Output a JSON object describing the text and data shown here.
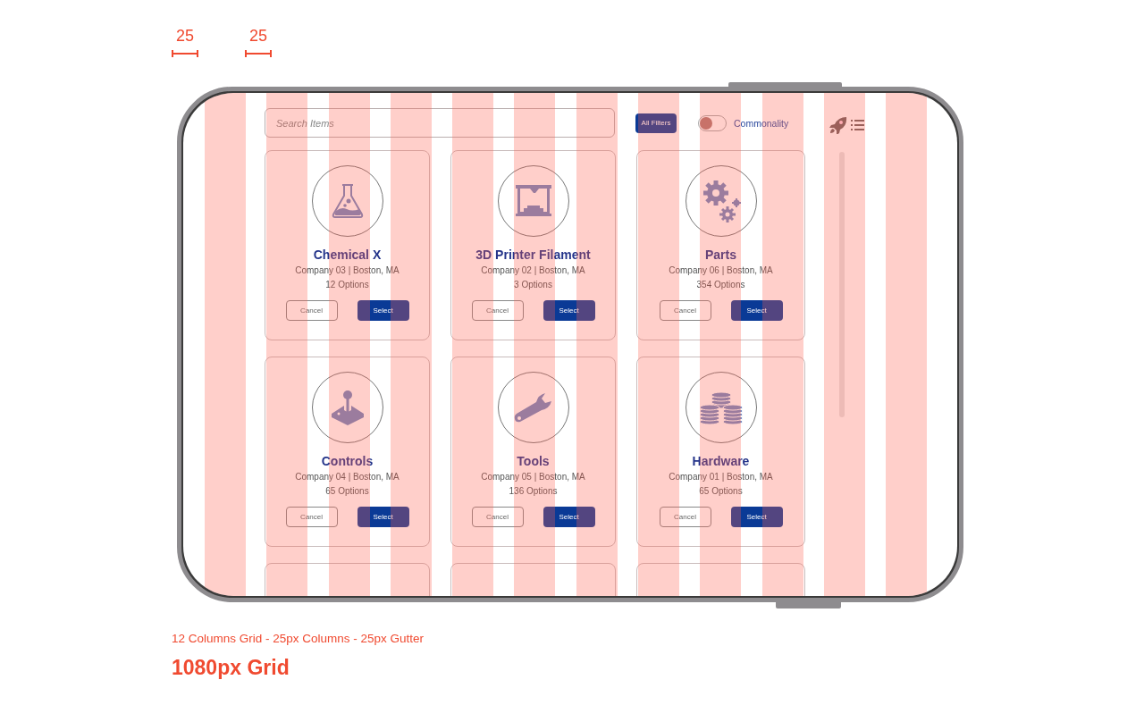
{
  "measure_labels": [
    "25",
    "25"
  ],
  "toolbar": {
    "search": {
      "placeholder": "Search Items"
    },
    "filters_button": "All Filters",
    "toggle": {
      "label": "Commonality",
      "on": false
    }
  },
  "cards": [
    {
      "kind": "item",
      "title": "Chemical X",
      "company": "Company 03 | Boston, MA",
      "options": "12 Options",
      "cancel_button": "Cancel",
      "select_button": "Select"
    },
    {
      "kind": "item",
      "title": "3D Printer Filament",
      "company": "Company 02 | Boston, MA",
      "options": "3 Options",
      "cancel_button": "Cancel",
      "select_button": "Select"
    },
    {
      "kind": "item",
      "title": "Parts",
      "company": "Company 06 | Boston, MA",
      "options": "354 Options",
      "cancel_button": "Cancel",
      "select_button": "Select"
    },
    {
      "kind": "item",
      "title": "Controls",
      "company": "Company 04 | Boston, MA",
      "options": "65 Options",
      "cancel_button": "Cancel",
      "select_button": "Select"
    },
    {
      "kind": "item",
      "title": "Tools",
      "company": "Company 05 | Boston, MA",
      "options": "136 Options",
      "cancel_button": "Cancel",
      "select_button": "Select"
    },
    {
      "kind": "item",
      "title": "Hardware",
      "company": "Company 01 | Boston, MA",
      "options": "65 Options",
      "cancel_button": "Cancel",
      "select_button": "Select"
    },
    {
      "kind": "partial"
    },
    {
      "kind": "partial"
    },
    {
      "kind": "partial"
    }
  ],
  "caption": "12 Columns Grid - 25px Columns - 25px Gutter",
  "heading": "1080px Grid"
}
